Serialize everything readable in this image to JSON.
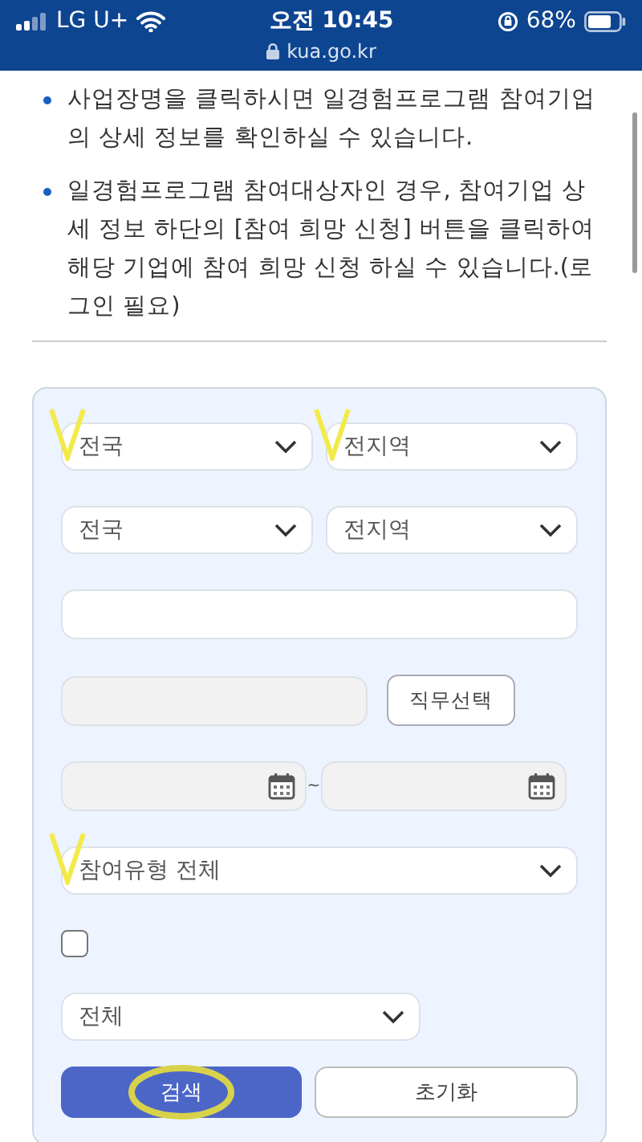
{
  "status_bar": {
    "carrier": "LG U+",
    "time": "오전 10:45",
    "battery": "68%",
    "url": "kua.go.kr"
  },
  "notes": [
    "사업장명을 클릭하시면 일경험프로그램 참여기업의 상세 정보를 확인하실 수 있습니다.",
    "일경험프로그램 참여대상자인 경우, 참여기업 상세 정보 하단의 [참여 희망 신청] 버튼을 클릭하여 해당 기업에 참여 희망 신청 하실 수 있습니다.(로그인 필요)"
  ],
  "form": {
    "region_row_1": [
      {
        "value": "전국",
        "marked": true
      },
      {
        "value": "전지역",
        "marked": true
      }
    ],
    "region_row_2": [
      {
        "value": "전국",
        "marked": false
      },
      {
        "value": "전지역",
        "marked": false
      }
    ],
    "job_button": "직무선택",
    "date_separator": "~",
    "participation_type": {
      "value": "참여유형 전체",
      "marked": true
    },
    "checkbox": {
      "checked": false
    },
    "filter": {
      "value": "전체"
    },
    "search_button": {
      "label": "검색",
      "marked": true
    },
    "reset_button": "초기화"
  }
}
